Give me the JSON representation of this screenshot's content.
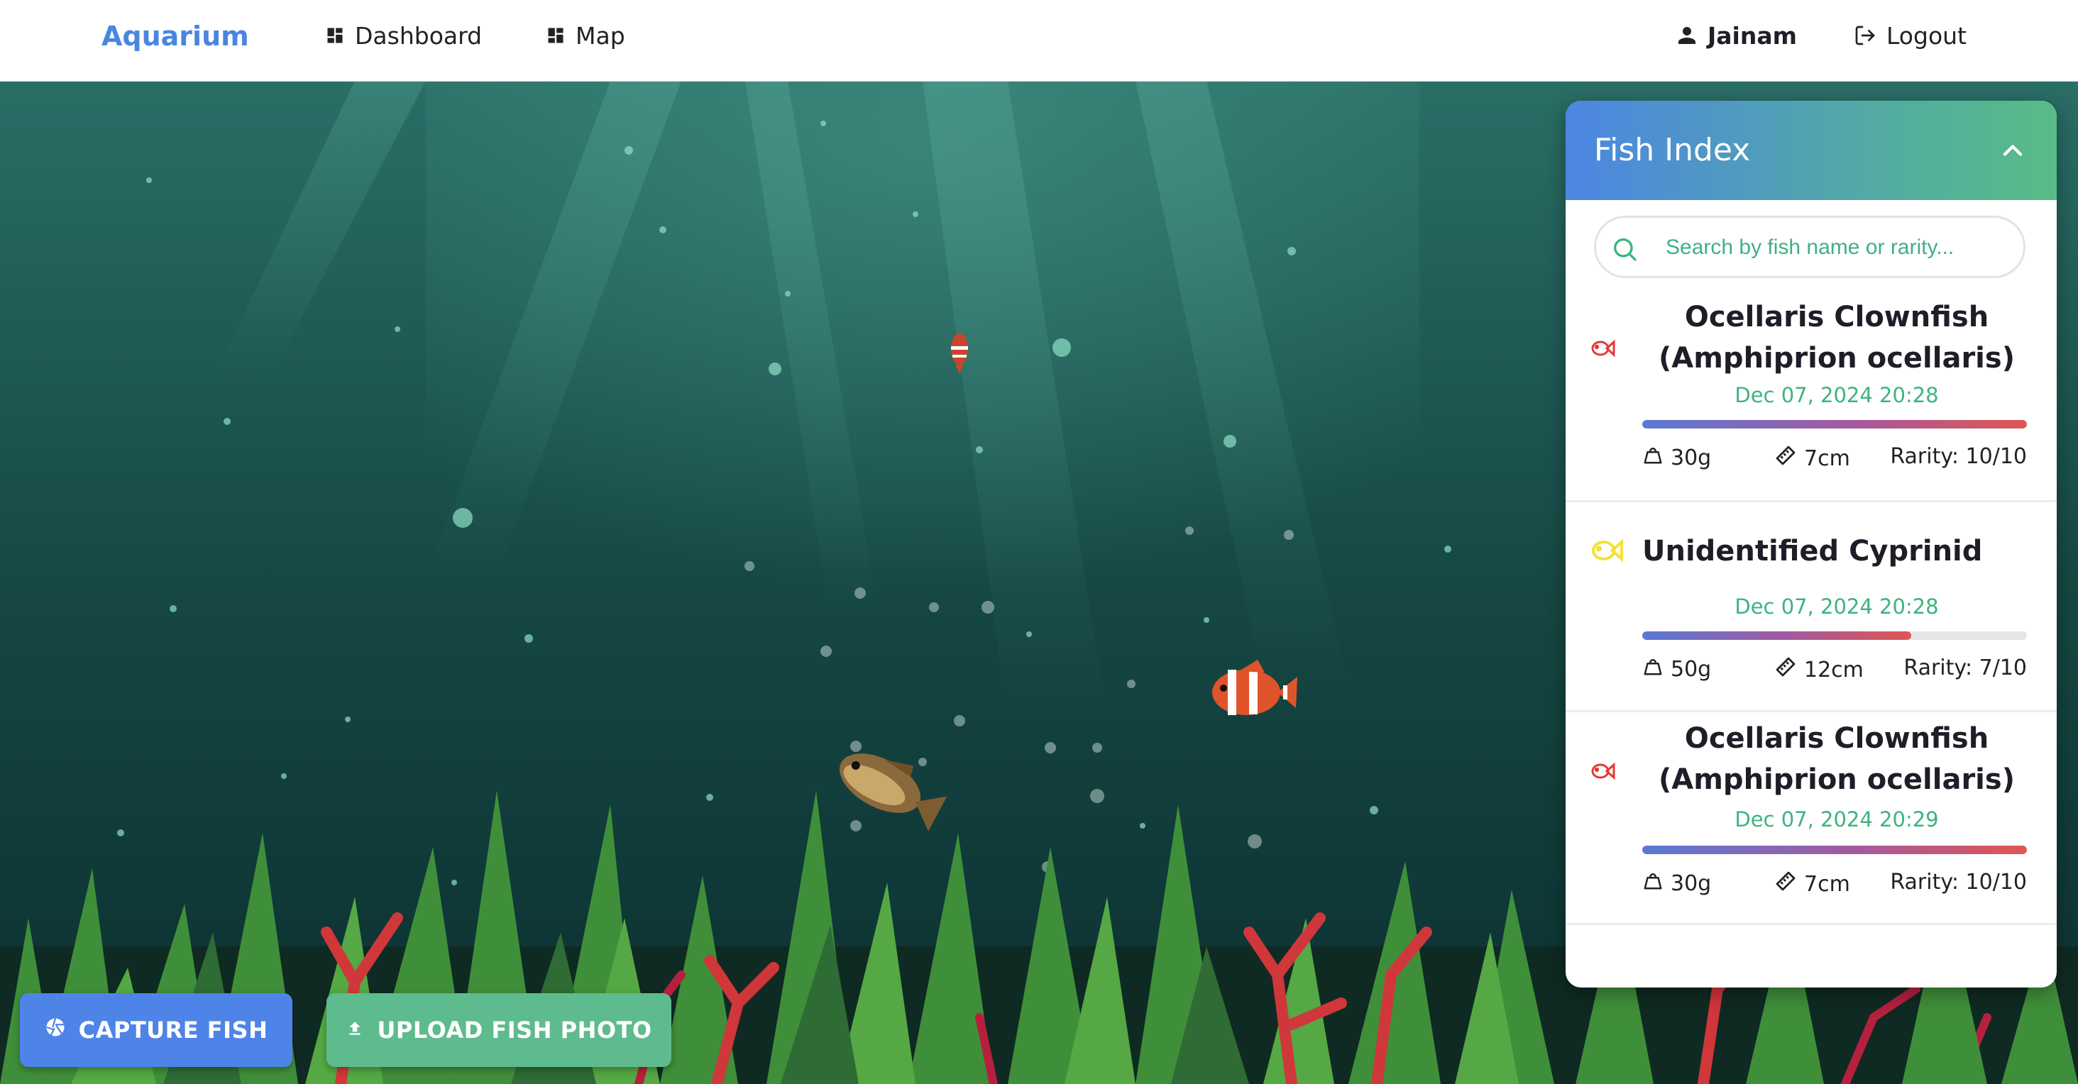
{
  "navbar": {
    "brand": "Aquarium",
    "links": [
      {
        "label": "Dashboard",
        "icon": "dashboard-icon"
      },
      {
        "label": "Map",
        "icon": "dashboard-icon"
      }
    ],
    "user": {
      "name": "Jainam",
      "icon": "user-icon"
    },
    "logout": {
      "label": "Logout",
      "icon": "logout-icon"
    }
  },
  "fish_index": {
    "title": "Fish Index",
    "search_placeholder": "Search by fish name or rarity...",
    "items": [
      {
        "name_line1": "Ocellaris Clownfish",
        "name_line2": "(Amphiprion ocellaris)",
        "icon": "fish-icon",
        "icon_color": "#e53935",
        "date": "Dec 07, 2024 20:28",
        "rarity_fraction": 1.0,
        "weight": "30g",
        "length": "7cm",
        "rarity": "Rarity: 10/10"
      },
      {
        "name_line1": "Unidentified Cyprinid",
        "icon": "fish-icon",
        "icon_color": "#f2e23a",
        "date": "Dec 07, 2024 20:28",
        "rarity_fraction": 0.7,
        "weight": "50g",
        "length": "12cm",
        "rarity": "Rarity: 7/10"
      },
      {
        "name_line1": "Ocellaris Clownfish",
        "name_line2": "(Amphiprion ocellaris)",
        "icon": "fish-icon",
        "icon_color": "#e53935",
        "date": "Dec 07, 2024 20:29",
        "rarity_fraction": 1.0,
        "weight": "30g",
        "length": "7cm",
        "rarity": "Rarity: 10/10"
      }
    ]
  },
  "actions": {
    "capture": {
      "label": "CAPTURE FISH",
      "icon": "aperture-icon",
      "color": "#4e84e8"
    },
    "upload": {
      "label": "UPLOAD FISH PHOTO",
      "icon": "upload-icon",
      "color": "#5dbb8e"
    }
  },
  "colors": {
    "brand": "#4a86e0",
    "accent_green": "#3eb37f",
    "water_top": "#2a6e66",
    "water_bottom": "#0b2f30"
  }
}
